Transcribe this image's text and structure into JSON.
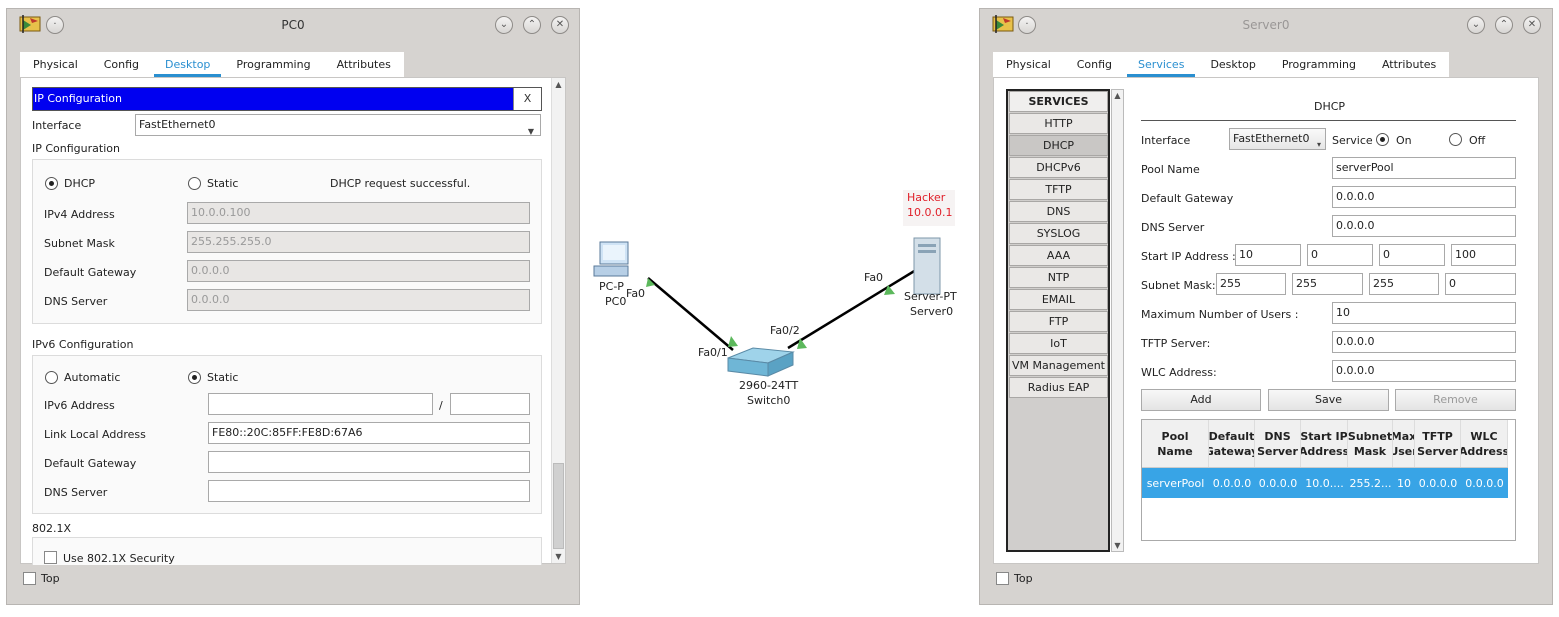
{
  "pc_window": {
    "title": "PC0",
    "tabs": [
      "Physical",
      "Config",
      "Desktop",
      "Programming",
      "Attributes"
    ],
    "active_tab": "Desktop",
    "ip_config": {
      "header": "IP Configuration",
      "close_label": "X",
      "interface_label": "Interface",
      "interface_value": "FastEthernet0",
      "ipv4_section": "IP Configuration",
      "dhcp_label": "DHCP",
      "static_label": "Static",
      "mode": "DHCP",
      "status_message": "DHCP request successful.",
      "ipv4_address_label": "IPv4 Address",
      "ipv4_address": "10.0.0.100",
      "subnet_mask_label": "Subnet Mask",
      "subnet_mask": "255.255.255.0",
      "default_gateway_label": "Default Gateway",
      "default_gateway": "0.0.0.0",
      "dns_server_label": "DNS Server",
      "dns_server": "0.0.0.0",
      "ipv6_section": "IPv6 Configuration",
      "automatic_label": "Automatic",
      "ipv6_static_label": "Static",
      "ipv6_mode": "Static",
      "ipv6_address_label": "IPv6 Address",
      "ipv6_address": "",
      "ipv6_prefix_separator": "/",
      "ipv6_prefix": "",
      "link_local_label": "Link Local Address",
      "link_local": "FE80::20C:85FF:FE8D:67A6",
      "ipv6_gateway_label": "Default Gateway",
      "ipv6_gateway": "",
      "ipv6_dns_label": "DNS Server",
      "ipv6_dns": "",
      "dot1x_section": "802.1X",
      "dot1x_label": "Use 802.1X Security"
    },
    "top_label": "Top"
  },
  "topology": {
    "pc_label1": "PC-P",
    "pc_label2": "PC0",
    "pc_port": "Fa0",
    "switch_port1": "Fa0/1",
    "switch_port2": "Fa0/2",
    "switch_label1": "2960-24TT",
    "switch_label2": "Switch0",
    "server_port": "Fa0",
    "server_label1": "Server-PT",
    "server_label2": "Server0",
    "note_line1": "Hacker",
    "note_line2": "10.0.0.1",
    "link_color": "#000000",
    "port_up_color": "#5cb85c",
    "note_color": "#e0202a"
  },
  "server_window": {
    "title": "Server0",
    "tabs": [
      "Physical",
      "Config",
      "Services",
      "Desktop",
      "Programming",
      "Attributes"
    ],
    "active_tab": "Services",
    "services_header": "SERVICES",
    "services": [
      "HTTP",
      "DHCP",
      "DHCPv6",
      "TFTP",
      "DNS",
      "SYSLOG",
      "AAA",
      "NTP",
      "EMAIL",
      "FTP",
      "IoT",
      "VM Management",
      "Radius EAP"
    ],
    "selected_service": "DHCP",
    "dhcp": {
      "title": "DHCP",
      "interface_label": "Interface",
      "interface_value": "FastEthernet0",
      "service_label": "Service",
      "on_label": "On",
      "off_label": "Off",
      "service_state": "On",
      "pool_name_label": "Pool Name",
      "pool_name": "serverPool",
      "default_gateway_label": "Default Gateway",
      "default_gateway": "0.0.0.0",
      "dns_server_label": "DNS Server",
      "dns_server": "0.0.0.0",
      "start_ip_label": "Start IP Address :",
      "start_ip": [
        "10",
        "0",
        "0",
        "100"
      ],
      "subnet_mask_label": "Subnet Mask:",
      "subnet_mask": [
        "255",
        "255",
        "255",
        "0"
      ],
      "max_users_label": "Maximum Number of Users :",
      "max_users": "10",
      "tftp_label": "TFTP Server:",
      "tftp": "0.0.0.0",
      "wlc_label": "WLC Address:",
      "wlc": "0.0.0.0",
      "add_label": "Add",
      "save_label": "Save",
      "remove_label": "Remove",
      "table_headers": [
        "Pool Name",
        "Default Gateway",
        "DNS Server",
        "Start IP Address",
        "Subnet Mask",
        "Max User",
        "TFTP Server",
        "WLC Address"
      ],
      "table_rows": [
        [
          "serverPool",
          "0.0.0.0",
          "0.0.0.0",
          "10.0....",
          "255.2...",
          "10",
          "0.0.0.0",
          "0.0.0.0"
        ]
      ]
    },
    "top_label": "Top"
  }
}
